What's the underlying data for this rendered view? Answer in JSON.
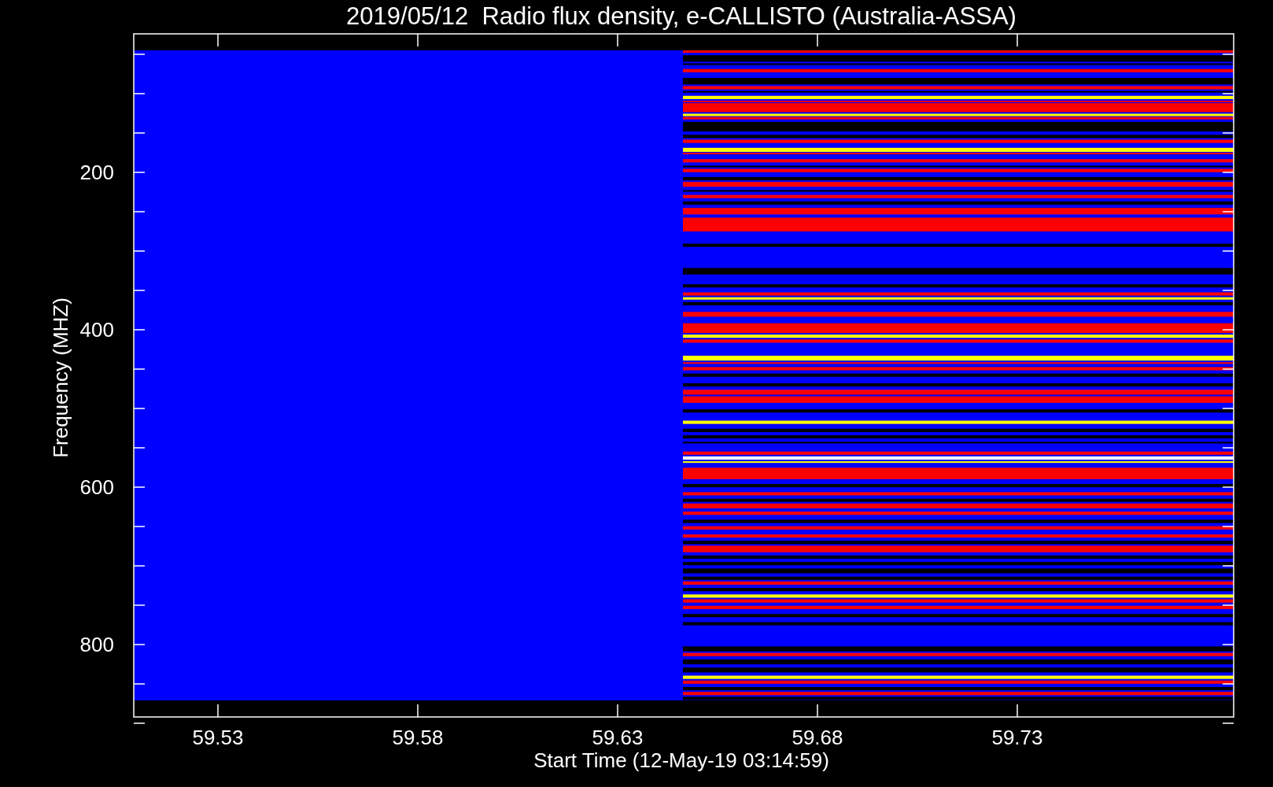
{
  "chart": {
    "title": "2019/05/12  Radio flux density, e-CALLISTO (Australia-ASSA)",
    "ylabel": "Frequency (MHZ)",
    "xlabel": "Start Time (12-May-19 03:14:59)",
    "yticks": [
      "200",
      "400",
      "600",
      "800"
    ],
    "xticks": [
      "59.53",
      "59.58",
      "59.63",
      "59.68",
      "59.73"
    ]
  }
}
